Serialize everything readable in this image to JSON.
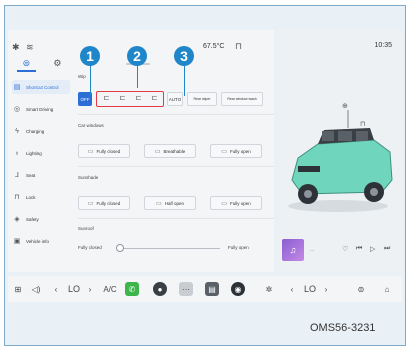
{
  "status": {
    "temperature": "67.5°C",
    "time": "10:35"
  },
  "sidebar": {
    "items": [
      {
        "label": "Shortcut Control",
        "icon": "shortcut-icon"
      },
      {
        "label": "Smart Driving",
        "icon": "steering-icon"
      },
      {
        "label": "Charging",
        "icon": "charging-icon"
      },
      {
        "label": "Lighting",
        "icon": "lightbulb-icon"
      },
      {
        "label": "Seat",
        "icon": "seat-icon"
      },
      {
        "label": "Lock",
        "icon": "lock-icon"
      },
      {
        "label": "Safety",
        "icon": "shield-icon"
      },
      {
        "label": "Vehicle info",
        "icon": "info-icon"
      }
    ]
  },
  "wiper": {
    "label": "Wip",
    "off": "OFF",
    "auto": "AUTO",
    "rear_wiper": "Rear wiper",
    "rear_window_wash": "Rear window wash"
  },
  "car_windows": {
    "label": "Car windows",
    "fully_closed": "Fully closed",
    "breathable": "Breathable",
    "fully_open": "Fully open"
  },
  "sunshade": {
    "label": "Sunshade",
    "fully_closed": "Fully closed",
    "half_open": "Half open",
    "fully_open": "Fully open"
  },
  "sunroof": {
    "label": "Sunroof",
    "min_label": "Fully closed",
    "max_label": "Fully open",
    "level": 0
  },
  "callouts": [
    "1",
    "2",
    "3"
  ],
  "dock": {
    "left_temp": "LO",
    "ac": "A/C",
    "right_temp": "LO"
  },
  "media": {
    "dots": "..."
  },
  "figure_code": "OMS56-3231",
  "colors": {
    "accent": "#2b6fd6",
    "callout": "#1f86c9",
    "highlight": "#e63946",
    "car": "#6fd6bd"
  }
}
